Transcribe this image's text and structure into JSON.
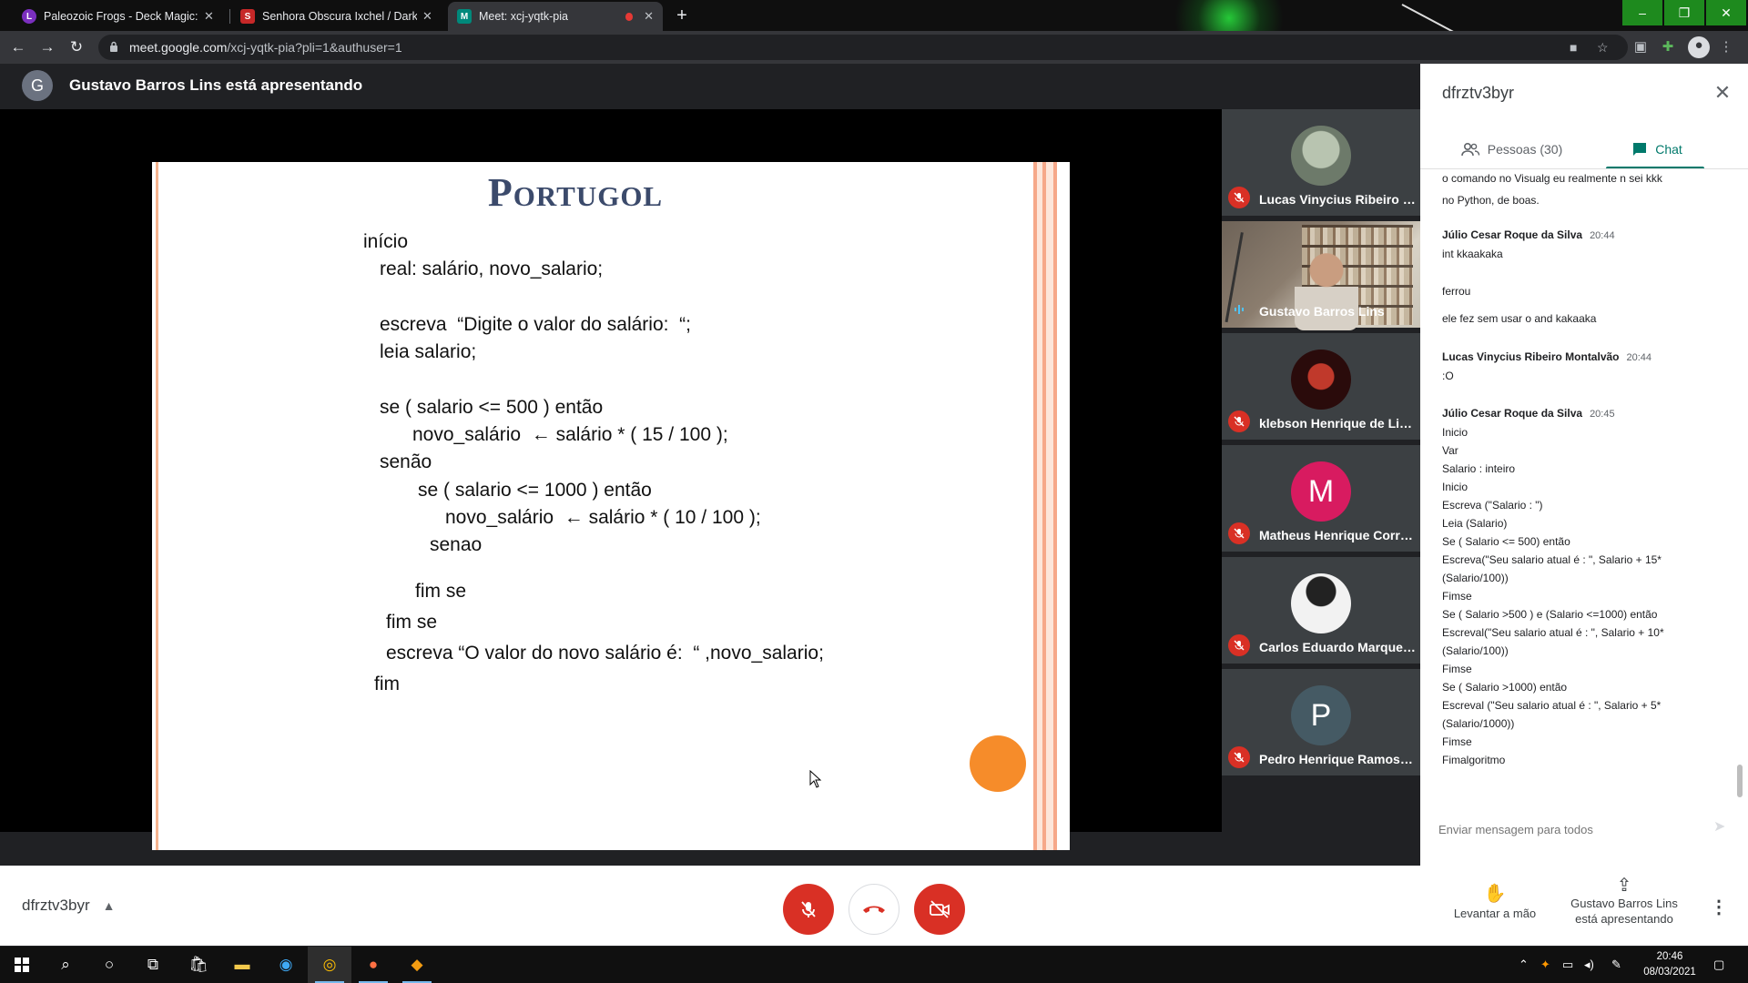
{
  "browser": {
    "tabs": [
      {
        "title": "Paleozoic Frogs - Deck Magic: Th",
        "favicon_color": "#7b2fbf",
        "favicon_letter": "L"
      },
      {
        "title": "Senhora Obscura Ixchel / Darklor",
        "favicon_color": "#c62828",
        "favicon_letter": "S"
      },
      {
        "title": "Meet: xcj-yqtk-pia",
        "favicon_color": "#00897b",
        "favicon_letter": "M"
      }
    ],
    "url_domain": "meet.google.com",
    "url_path": "/xcj-yqtk-pia?pli=1&authuser=1"
  },
  "meet": {
    "presenter_initial": "G",
    "presenter_text": "Gustavo Barros Lins está apresentando",
    "slide": {
      "title": "Portugol",
      "lines": [
        "início",
        "real: salário, novo_salario;",
        "escreva  “Digite o valor do salário:  “;",
        "leia salario;",
        "se ( salario <= 500 ) então",
        "novo_salário  ← salário * ( 15 / 100 );",
        "senão",
        "se ( salario <= 1000 ) então",
        "novo_salário  ← salário * ( 10 / 100 );",
        "senao",
        "fim se",
        "fim se",
        "escreva “O valor do novo salário é:  “ ,novo_salario;",
        "fim"
      ]
    },
    "participants": [
      {
        "name": "Lucas Vinycius Ribeiro M...",
        "avatar": "photo",
        "avatar_color": "#8a9a8a",
        "muted": true
      },
      {
        "name": "Gustavo Barros Lins",
        "avatar": "video",
        "muted": false
      },
      {
        "name": "klebson Henrique de Lima",
        "avatar": "photo",
        "avatar_color": "#3a1212",
        "muted": true
      },
      {
        "name": "Matheus Henrique Correi...",
        "avatar": "letter",
        "letter": "M",
        "avatar_color": "#d81b60",
        "muted": true
      },
      {
        "name": "Carlos Eduardo Marque d...",
        "avatar": "photo",
        "avatar_color": "#e8e8e8",
        "muted": true
      },
      {
        "name": "Pedro Henrique Ramos d...",
        "avatar": "letter",
        "letter": "P",
        "avatar_color": "#455a64",
        "muted": true
      }
    ]
  },
  "panel": {
    "title": "dfrztv3byr",
    "tab_people": "Pessoas (30)",
    "tab_chat": "Chat",
    "messages": [
      {
        "sender": "",
        "time": "",
        "lines": [
          "o comando no Visualg eu realmente n sei kkk"
        ]
      },
      {
        "sender": "",
        "time": "",
        "lines": [
          "no Python, de boas."
        ]
      },
      {
        "sender": "Júlio Cesar Roque da Silva",
        "time": "20:44",
        "lines": [
          "int kkaakaka"
        ]
      },
      {
        "sender": "",
        "time": "",
        "lines": [
          "ferrou"
        ]
      },
      {
        "sender": "",
        "time": "",
        "lines": [
          "ele fez sem usar o and kakaaka"
        ]
      },
      {
        "sender": "Lucas Vinycius Ribeiro Montalvão",
        "time": "20:44",
        "lines": [
          ":O"
        ]
      },
      {
        "sender": "Júlio Cesar Roque da Silva",
        "time": "20:45",
        "lines": [
          "Inicio",
          "Var",
          "Salario : inteiro",
          "Inicio",
          "Escreva (\"Salario : \")",
          "Leia (Salario)",
          "Se ( Salario <= 500) então",
          "Escreva(\"Seu salario atual é : \", Salario + 15*",
          "(Salario/100))",
          "Fimse",
          "Se ( Salario >500 ) e (Salario <=1000) então",
          "Escreval(\"Seu salario atual é : \", Salario + 10*",
          "(Salario/100))",
          "Fimse",
          "Se ( Salario >1000) então",
          "Escreval (\"Seu salario atual é : \", Salario + 5*",
          "(Salario/1000))",
          "Fimse",
          "Fimalgoritmo"
        ]
      }
    ],
    "input_placeholder": "Enviar mensagem para todos"
  },
  "controls": {
    "meeting_code": "dfrztv3byr",
    "raise_hand": "Levantar a mão",
    "presenting_line1": "Gustavo Barros Lins",
    "presenting_line2": "está apresentando"
  },
  "taskbar": {
    "time": "20:46",
    "date": "08/03/2021"
  },
  "colors": {
    "meet_red": "#d93025",
    "chat_accent": "#00796b",
    "slide_title": "#3b4a6b",
    "orange_dot": "#f68c2a"
  }
}
